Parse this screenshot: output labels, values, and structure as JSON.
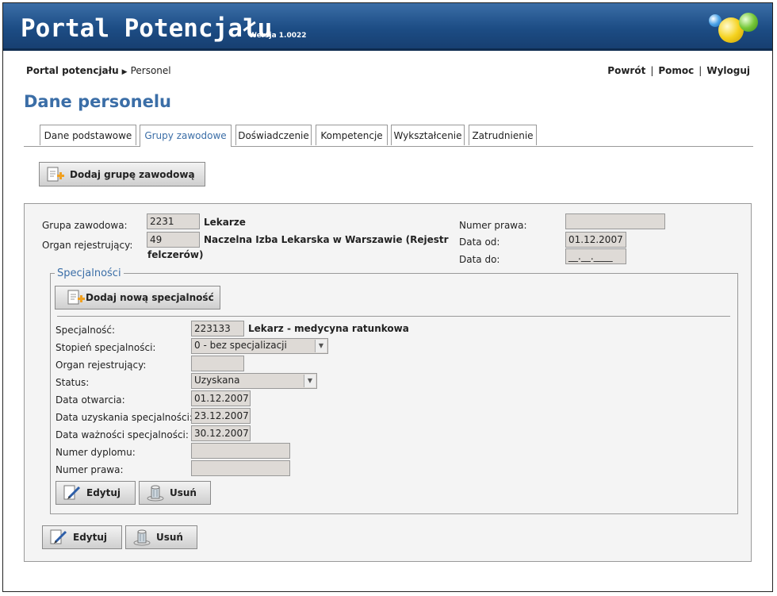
{
  "header": {
    "title": "Portal Potencjału",
    "version": "Wersja 1.0022"
  },
  "breadcrumb": {
    "root": "Portal potencjału",
    "current": "Personel"
  },
  "top_links": {
    "back": "Powrót",
    "help": "Pomoc",
    "logout": "Wyloguj",
    "sep": "|"
  },
  "page_title": "Dane personelu",
  "tabs": [
    "Dane podstawowe",
    "Grupy zawodowe",
    "Doświadczenie",
    "Kompetencje",
    "Wykształcenie",
    "Zatrudnienie"
  ],
  "active_tab": "Grupy zawodowe",
  "add_group_button": "Dodaj grupę zawodową",
  "group": {
    "grupa_label": "Grupa zawodowa:",
    "grupa_code": "2231",
    "grupa_name": "Lekarze",
    "organ_label": "Organ rejestrujący:",
    "organ_code": "49",
    "organ_name_line1": "Naczelna Izba Lekarska w Warszawie (Rejestr",
    "organ_name_line2": "felczerów)",
    "numer_prawa_label": "Numer prawa:",
    "numer_prawa": "",
    "data_od_label": "Data od:",
    "data_od": "01.12.2007",
    "data_do_label": "Data do:",
    "data_do": "__.__.____"
  },
  "specjalnosci": {
    "legend": "Specjalności",
    "add_button": "Dodaj nową specjalność",
    "specjalnosc_label": "Specjalność:",
    "specjalnosc_code": "223133",
    "specjalnosc_name": "Lekarz - medycyna ratunkowa",
    "stopien_label": "Stopień specjalności:",
    "stopien_value": "0 - bez specjalizacji",
    "organ_label": "Organ rejestrujący:",
    "organ_value": "",
    "status_label": "Status:",
    "status_value": "Uzyskana",
    "data_otwarcia_label": "Data otwarcia:",
    "data_otwarcia": "01.12.2007",
    "data_uzyskania_label": "Data uzyskania specjalności:",
    "data_uzyskania": "23.12.2007",
    "data_waznosci_label": "Data ważności specjalności:",
    "data_waznosci": "30.12.2007",
    "numer_dyplomu_label": "Numer dyplomu:",
    "numer_dyplomu": "",
    "numer_prawa_label": "Numer prawa:",
    "numer_prawa": "",
    "edit_button": "Edytuj",
    "delete_button": "Usuń"
  },
  "group_actions": {
    "edit_button": "Edytuj",
    "delete_button": "Usuń"
  },
  "colors": {
    "header": "#1d4d85",
    "accent": "#3b6ea7"
  }
}
